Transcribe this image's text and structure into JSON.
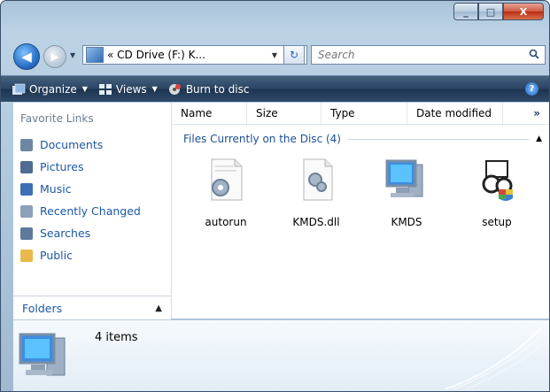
{
  "window": {
    "buttons": {
      "minimize": "_",
      "maximize": "□",
      "close": "X"
    }
  },
  "nav": {
    "back_icon": "back-arrow-icon",
    "forward_icon": "forward-arrow-icon"
  },
  "address": {
    "text": "« CD Drive (F:) K...",
    "refresh_symbol": "↻"
  },
  "search": {
    "placeholder": "Search"
  },
  "toolbar": {
    "organize": "Organize",
    "views": "Views",
    "burn": "Burn to disc",
    "help": "?"
  },
  "sidebar": {
    "header": "Favorite Links",
    "items": [
      {
        "label": "Documents",
        "color": "#6d86a3"
      },
      {
        "label": "Pictures",
        "color": "#4f6b8f"
      },
      {
        "label": "Music",
        "color": "#3d6fb5"
      },
      {
        "label": "Recently Changed",
        "color": "#8ca1ba"
      },
      {
        "label": "Searches",
        "color": "#5c7a9c"
      },
      {
        "label": "Public",
        "color": "#e9b94a"
      }
    ],
    "folders_label": "Folders"
  },
  "columns": [
    "Name",
    "Size",
    "Type",
    "Date modified"
  ],
  "columns_more": "»",
  "group": {
    "title": "Files Currently on the Disc (4)"
  },
  "files": [
    {
      "name": "autorun",
      "icon": "settings-file-icon"
    },
    {
      "name": "KMDS.dll",
      "icon": "dll-gear-icon"
    },
    {
      "name": "KMDS",
      "icon": "computer-app-icon"
    },
    {
      "name": "setup",
      "icon": "installer-shield-icon"
    }
  ],
  "details": {
    "count": "4 items"
  }
}
